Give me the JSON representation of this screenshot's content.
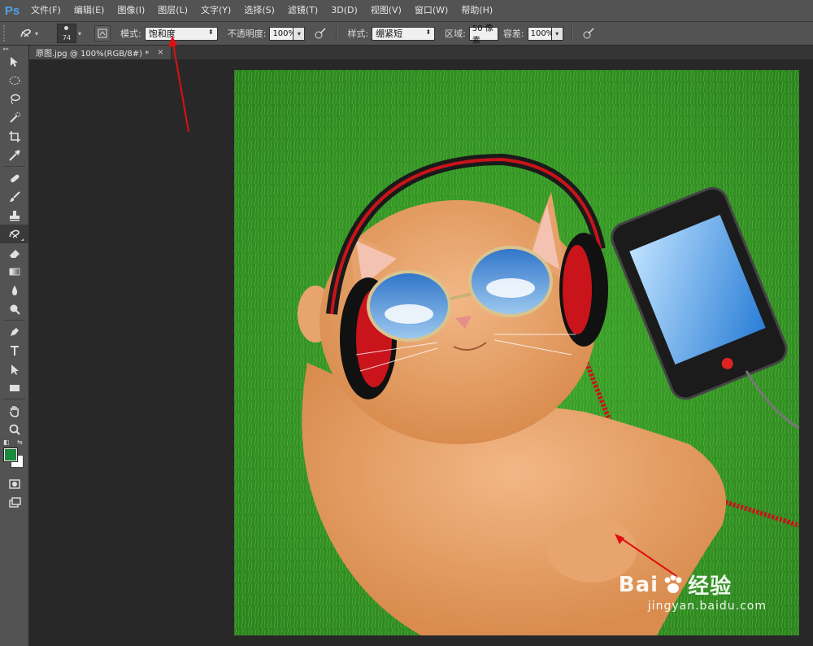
{
  "app": {
    "logo": "Ps"
  },
  "menu": [
    "文件(F)",
    "编辑(E)",
    "图像(I)",
    "图层(L)",
    "文字(Y)",
    "选择(S)",
    "滤镜(T)",
    "3D(D)",
    "视图(V)",
    "窗口(W)",
    "帮助(H)"
  ],
  "options": {
    "brush_size": "74",
    "mode_label": "模式:",
    "mode_value": "饱和度",
    "opacity_label": "不透明度:",
    "opacity_value": "100%",
    "style_label": "样式:",
    "style_value": "绷紧短",
    "area_label": "区域:",
    "area_value": "50 像素",
    "tolerance_label": "容差:",
    "tolerance_value": "100%"
  },
  "document": {
    "tab_title": "原图.jpg @ 100%(RGB/8#) *",
    "close": "×"
  },
  "colors": {
    "foreground": "#1a8a3c",
    "background": "#ffffff",
    "annotation": "#e01010"
  },
  "watermark": {
    "brand": "Bai",
    "brand_suffix": "经验",
    "url": "jingyan.baidu.com"
  },
  "tools": [
    "move-icon",
    "marquee-icon",
    "lasso-icon",
    "quick-select-icon",
    "crop-icon",
    "eyedropper-icon",
    "healing-icon",
    "brush-icon",
    "stamp-icon",
    "history-brush-icon",
    "eraser-icon",
    "gradient-icon",
    "blur-icon",
    "dodge-icon",
    "pen-icon",
    "type-icon",
    "path-select-icon",
    "shape-icon",
    "hand-icon",
    "zoom-icon"
  ]
}
